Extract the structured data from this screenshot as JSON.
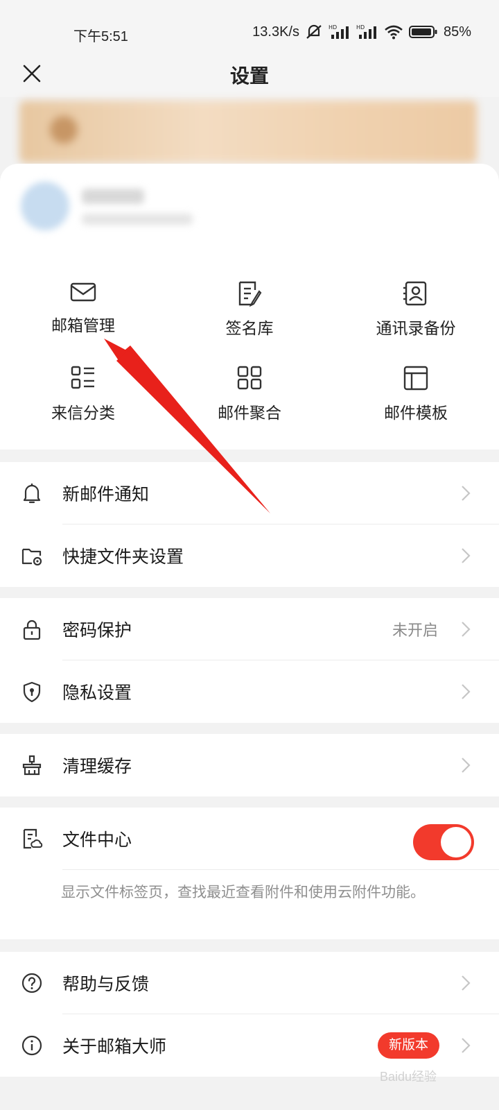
{
  "status_bar": {
    "time": "下午5:51",
    "network_speed": "13.3K/s",
    "battery": "85%"
  },
  "header": {
    "title": "设置"
  },
  "grid": [
    {
      "label": "邮箱管理",
      "icon": "mail-icon"
    },
    {
      "label": "签名库",
      "icon": "signature-icon"
    },
    {
      "label": "通讯录备份",
      "icon": "contact-backup-icon"
    },
    {
      "label": "来信分类",
      "icon": "list-category-icon"
    },
    {
      "label": "邮件聚合",
      "icon": "grid-aggregate-icon"
    },
    {
      "label": "邮件模板",
      "icon": "template-icon"
    }
  ],
  "groups": {
    "notifications": {
      "new_mail": "新邮件通知",
      "quick_folder": "快捷文件夹设置"
    },
    "security": {
      "password": "密码保护",
      "password_status": "未开启",
      "privacy": "隐私设置"
    },
    "storage": {
      "clear_cache": "清理缓存"
    },
    "files": {
      "file_center": "文件中心",
      "file_center_enabled": true,
      "description": "显示文件标签页，查找最近查看附件和使用云附件功能。"
    },
    "about": {
      "help": "帮助与反馈",
      "about_app": "关于邮箱大师",
      "new_version_badge": "新版本"
    }
  },
  "colors": {
    "accent": "#f23a2c",
    "annotation_arrow": "#e8211b"
  },
  "watermark": "Baidu经验"
}
